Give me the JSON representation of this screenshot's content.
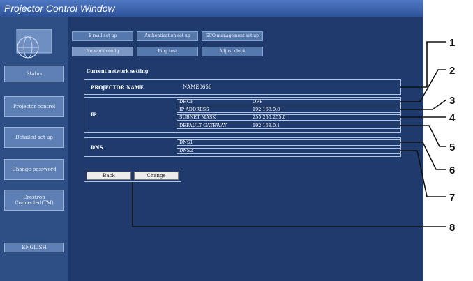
{
  "window": {
    "title": "Projector Control Window"
  },
  "sidebar": {
    "items": [
      {
        "id": "status",
        "label": "Status"
      },
      {
        "id": "projector-control",
        "label": "Projector control"
      },
      {
        "id": "detailed-set-up",
        "label": "Detailed set up"
      },
      {
        "id": "change-password",
        "label": "Change password"
      },
      {
        "id": "crestron",
        "label": "Crestron Connected(TM)"
      },
      {
        "id": "language",
        "label": "ENGLISH"
      }
    ]
  },
  "tabs": {
    "row1": [
      "E-mail set up",
      "Authentication set up",
      "ECO management set up"
    ],
    "row2": [
      "Network config",
      "Ping test",
      "Adjust clock"
    ]
  },
  "network": {
    "section_title": "Current network setting",
    "projector_name_label": "PROJECTOR NAME",
    "projector_name_value": "NAME0656",
    "ip_label": "IP",
    "dhcp_label": "DHCP",
    "dhcp_value": "OFF",
    "ip_address_label": "IP ADDRESS",
    "ip_address_value": "192.168.0.8",
    "subnet_label": "SUBNET MASK",
    "subnet_value": "255.255.255.0",
    "gateway_label": "DEFAULT GATEWAY",
    "gateway_value": "192.168.0.1",
    "dns_label": "DNS",
    "dns1_label": "DNS1",
    "dns2_label": "DNS2"
  },
  "buttons": {
    "back": "Back",
    "change": "Change"
  },
  "callouts": [
    "1",
    "2",
    "3",
    "4",
    "5",
    "6",
    "7",
    "8"
  ],
  "colors": {
    "background": "#1f3b6e",
    "sidebar": "#2d4f86",
    "tab": "#5679ad",
    "title_bar": "#3b66b0"
  }
}
